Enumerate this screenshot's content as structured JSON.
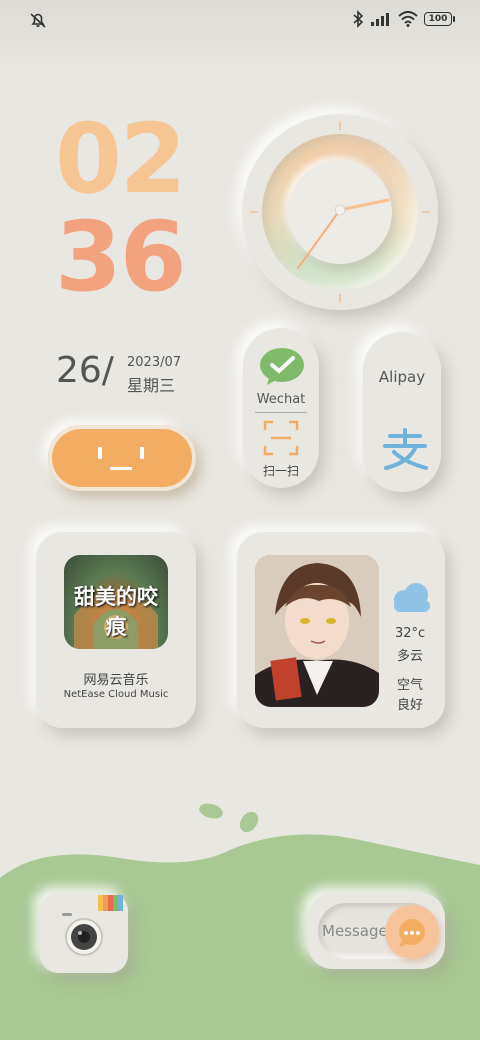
{
  "status_bar": {
    "battery": "100"
  },
  "clock": {
    "hour": "02",
    "minute": "36"
  },
  "date": {
    "day": "26/",
    "year_month": "2023/07",
    "weekday": "星期三"
  },
  "apps": {
    "wechat": {
      "label": "Wechat",
      "scan_label": "扫一扫"
    },
    "alipay": {
      "label": "Alipay"
    },
    "music": {
      "title": "网易云音乐",
      "subtitle": "NetEase Cloud Music",
      "cover_text": "甜美的咬痕"
    },
    "weather": {
      "temp": "32°c",
      "condition": "多云",
      "air_label": "空气",
      "air_value": "良好"
    },
    "message": {
      "label": "Message"
    }
  },
  "colors": {
    "accent_orange": "#f3ad62",
    "clock_hour": "#f6c594",
    "clock_minute": "#f2a27f",
    "wechat_green": "#7fba6a",
    "alipay_blue": "#6fb2dc",
    "ground_green": "#a9c893"
  }
}
